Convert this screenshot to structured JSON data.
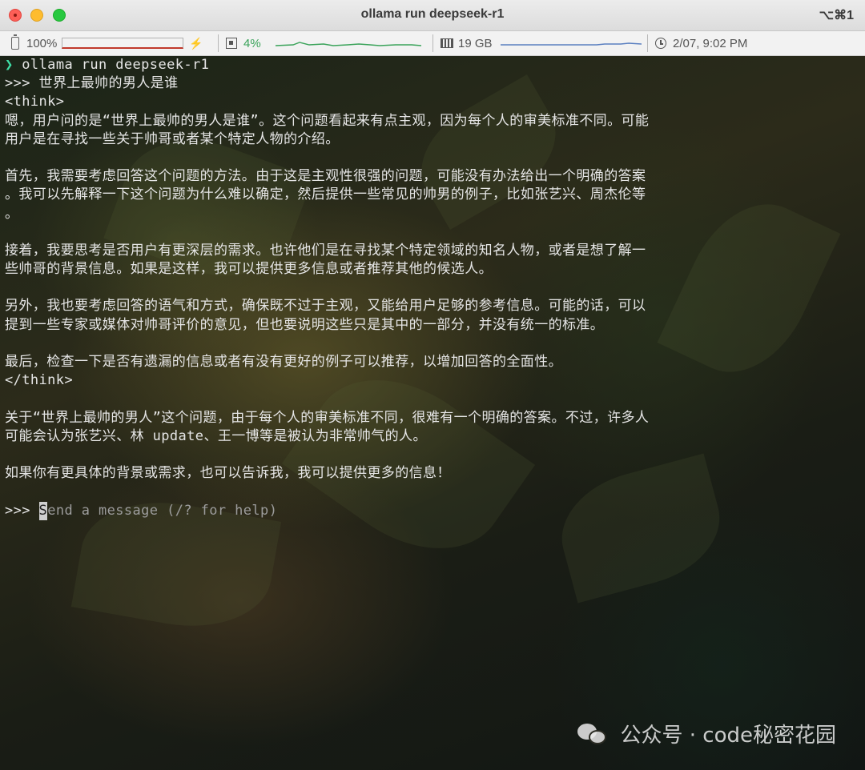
{
  "window": {
    "title": "ollama run deepseek-r1",
    "shortcut": "⌥⌘1"
  },
  "statusbar": {
    "battery_label": "100%",
    "battery_level": 1.0,
    "bolt_icon": "⚡",
    "cpu_label": "4%",
    "memory_label": "19 GB",
    "datetime_label": "2/07, 9:02 PM"
  },
  "terminal": {
    "lines": [
      "ollama run deepseek-r1",
      ">>> 世界上最帅的男人是谁",
      "<think>",
      "嗯，用户问的是“世界上最帅的男人是谁”。这个问题看起来有点主观，因为每个人的审美标准不同。可能",
      "用户是在寻找一些关于帅哥或者某个特定人物的介绍。",
      "",
      "首先，我需要考虑回答这个问题的方法。由于这是主观性很强的问题，可能没有办法给出一个明确的答案",
      "。我可以先解释一下这个问题为什么难以确定，然后提供一些常见的帅男的例子，比如张艺兴、周杰伦等",
      "。",
      "",
      "接着，我要思考是否用户有更深层的需求。也许他们是在寻找某个特定领域的知名人物，或者是想了解一",
      "些帅哥的背景信息。如果是这样，我可以提供更多信息或者推荐其他的候选人。",
      "",
      "另外，我也要考虑回答的语气和方式，确保既不过于主观，又能给用户足够的参考信息。可能的话，可以",
      "提到一些专家或媒体对帅哥评价的意见，但也要说明这些只是其中的一部分，并没有统一的标准。",
      "",
      "最后，检查一下是否有遗漏的信息或者有没有更好的例子可以推荐，以增加回答的全面性。",
      "</think>",
      "",
      "关于“世界上最帅的男人”这个问题，由于每个人的审美标准不同，很难有一个明确的答案。不过，许多人",
      "可能会认为张艺兴、林 update、王一博等是被认为非常帅气的人。",
      "",
      "如果你有更具体的背景或需求，也可以告诉我，我可以提供更多的信息！",
      ""
    ],
    "prompt_symbol": "❯",
    "input_prompt": ">>>",
    "input_cursor_char": "S",
    "input_placeholder_rest": "end a message (/? for help)"
  },
  "watermark": {
    "icon": "wechat-icon",
    "text": "公众号 · code秘密花园"
  }
}
